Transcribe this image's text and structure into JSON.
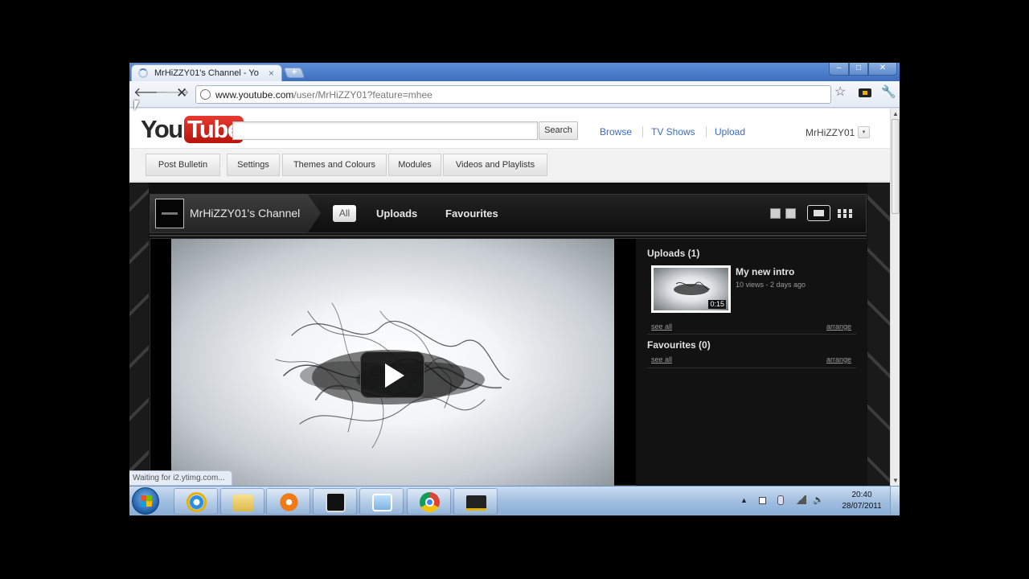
{
  "browser": {
    "tab_title": "MrHiZZY01's Channel - Yo",
    "tab_close": "×",
    "new_tab": "+",
    "url_host": "www.youtube.com",
    "url_path": "/user/MrHiZZY01?feature=mhee",
    "status_text": "Waiting for i2.ytimg.com...",
    "icons": {
      "back": "back-arrow-icon",
      "forward": "forward-arrow-icon",
      "stop": "stop-icon",
      "star": "bookmark-star-icon",
      "extension": "extension-icon",
      "wrench": "wrench-icon"
    },
    "glyphs": {
      "back": "🡐",
      "forward": "🡒",
      "stop": "✕",
      "star": "☆",
      "wrench": "🔧",
      "min": "–",
      "max": "□",
      "close": "✕"
    }
  },
  "youtube": {
    "logo_you": "You",
    "logo_tube": "Tube",
    "search_button": "Search",
    "search_value": "",
    "nav": {
      "browse": "Browse",
      "tv_shows": "TV Shows",
      "upload": "Upload"
    },
    "username": "MrHiZZY01",
    "user_dropdown": "▾",
    "edit_buttons": {
      "post_bulletin": "Post Bulletin",
      "settings": "Settings",
      "themes": "Themes and Colours",
      "modules": "Modules",
      "videos_playlists": "Videos and Playlists"
    }
  },
  "channel": {
    "title": "MrHiZZY01's Channel",
    "tabs": {
      "all": "All",
      "uploads": "Uploads",
      "favourites": "Favourites"
    },
    "selected_tab": "All",
    "sidebar": {
      "uploads_heading": "Uploads (1)",
      "favourites_heading": "Favourites (0)",
      "see_all": "see all",
      "arrange": "arrange",
      "video": {
        "title": "My new intro",
        "meta": "10 views - 2 days ago",
        "duration": "0:15"
      }
    },
    "colors": {
      "background": "#101010",
      "link": "#3c6cc0",
      "logo_red": "#cc2419"
    }
  },
  "taskbar": {
    "apps": [
      "internet-explorer-icon",
      "windows-explorer-icon",
      "media-player-icon",
      "house-app-icon",
      "photo-viewer-icon",
      "chrome-icon",
      "graduation-cap-app-icon"
    ],
    "tray": {
      "arrow": "▲",
      "volume": "🔈"
    },
    "time": "20:40",
    "date": "28/07/2011"
  }
}
